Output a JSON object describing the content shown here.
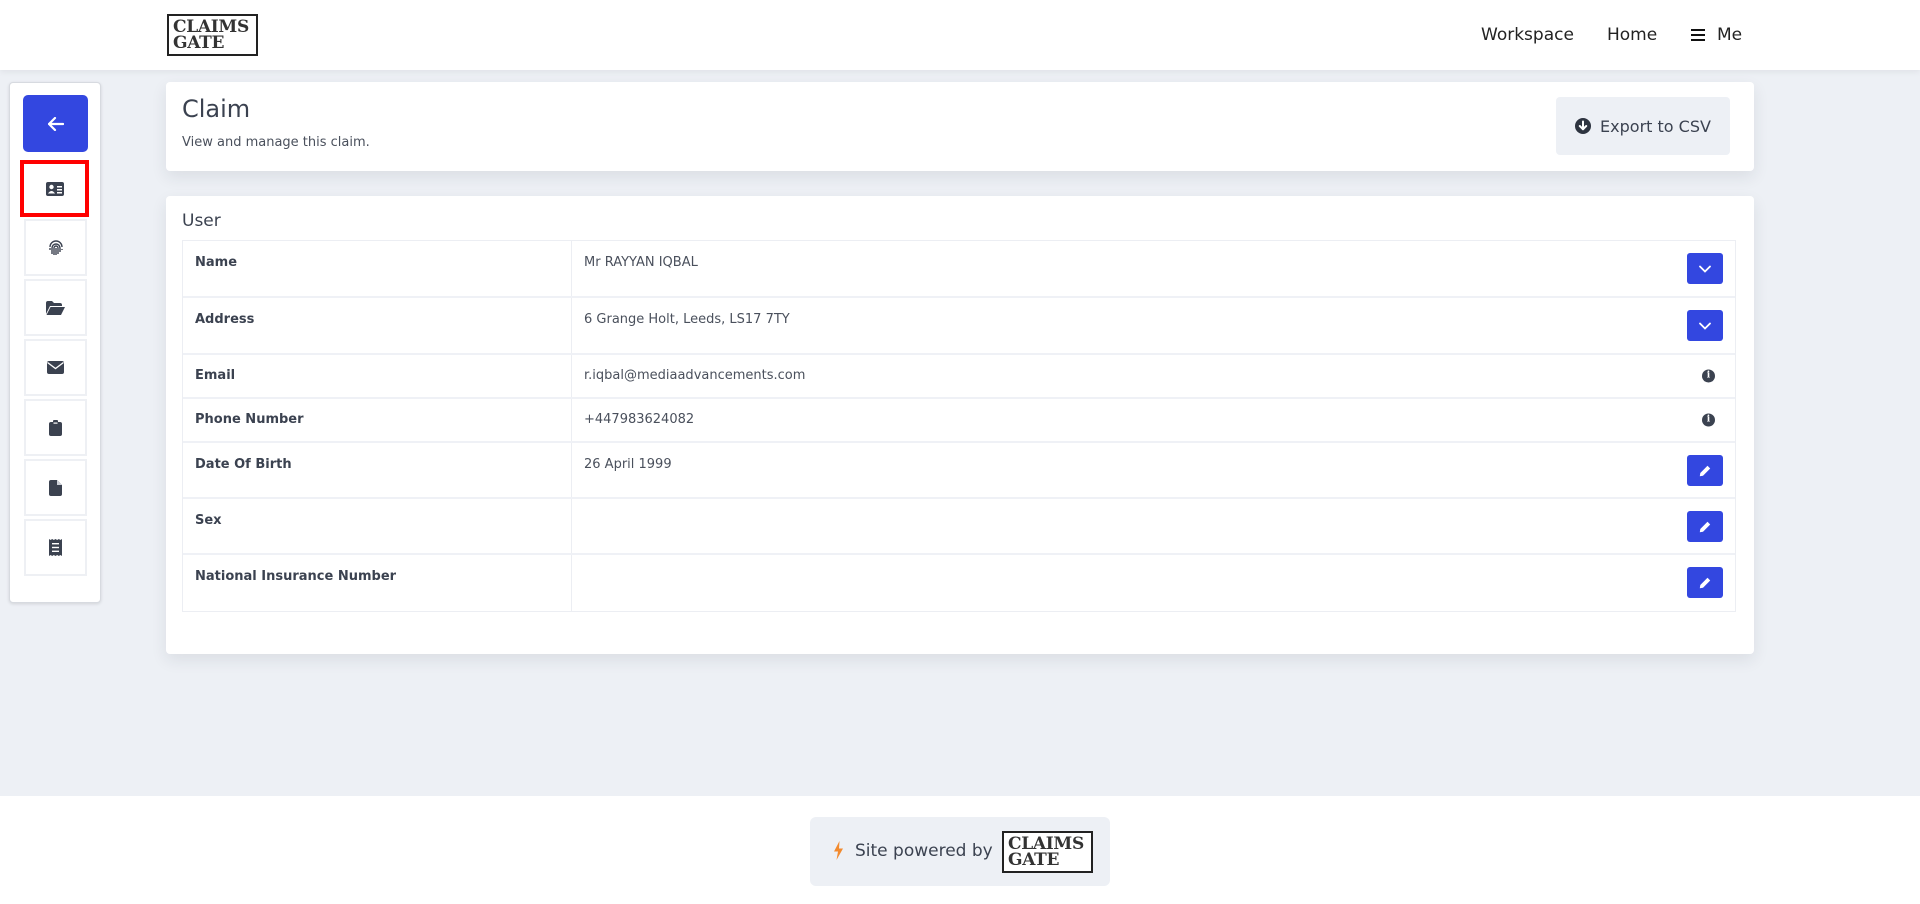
{
  "header": {
    "logo": {
      "line1": "CLAIMS",
      "line2": "GATE"
    },
    "nav": {
      "workspace": "Workspace",
      "home": "Home",
      "me": "Me",
      "menu_icon": "hamburger-icon"
    }
  },
  "sidebar": {
    "back_icon": "arrow-left-icon",
    "items": [
      {
        "icon": "id-card-icon",
        "active": true
      },
      {
        "icon": "fingerprint-icon",
        "active": false
      },
      {
        "icon": "folder-open-icon",
        "active": false
      },
      {
        "icon": "envelope-icon",
        "active": false
      },
      {
        "icon": "clipboard-icon",
        "active": false
      },
      {
        "icon": "file-icon",
        "active": false
      },
      {
        "icon": "receipt-icon",
        "active": false
      }
    ]
  },
  "claim": {
    "title": "Claim",
    "subtitle": "View and manage this claim.",
    "export_label": "Export to CSV",
    "export_icon": "circle-arrow-down-icon"
  },
  "user_section": {
    "title": "User",
    "rows": [
      {
        "label": "Name",
        "value": "Mr RAYYAN IQBAL",
        "action": "expand"
      },
      {
        "label": "Address",
        "value": "6 Grange Holt, Leeds, LS17 7TY",
        "action": "expand"
      },
      {
        "label": "Email",
        "value": "r.iqbal@mediaadvancements.com",
        "action": "info"
      },
      {
        "label": "Phone Number",
        "value": "+447983624082",
        "action": "info"
      },
      {
        "label": "Date Of Birth",
        "value": "26 April 1999",
        "action": "edit"
      },
      {
        "label": "Sex",
        "value": "",
        "action": "edit"
      },
      {
        "label": "National Insurance Number",
        "value": "",
        "action": "edit"
      }
    ]
  },
  "footer": {
    "powered_by": "Site powered by",
    "logo": {
      "line1": "CLAIMS",
      "line2": "GATE"
    }
  },
  "colors": {
    "primary": "#3347e0",
    "background": "#edf0f5",
    "highlight": "#ff0000",
    "bolt": "#f28a2e"
  }
}
